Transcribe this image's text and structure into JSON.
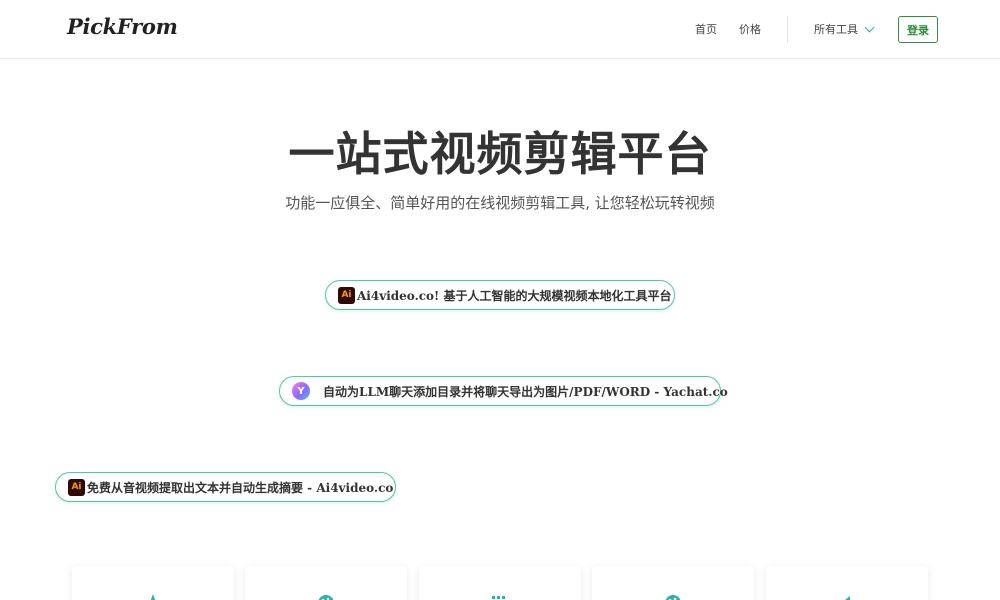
{
  "header": {
    "logo": "PickFrom",
    "nav": {
      "home": "首页",
      "pricing": "价格",
      "all_tools": "所有工具"
    },
    "login": "登录"
  },
  "hero": {
    "title": "一站式视频剪辑平台",
    "subtitle": "功能一应俱全、简单好用的在线视频剪辑工具, 让您轻松玩转视频"
  },
  "promos": [
    {
      "icon": "Ai",
      "text": "Ai4video.co! 基于人工智能的大规模视频本地化工具平台"
    },
    {
      "icon": "Y",
      "text": "自动为LLM聊天添加目录并将聊天导出为图片/PDF/WORD - Yachat.co"
    },
    {
      "icon": "Ai",
      "text": "免费从音视频提取出文本并自动生成摘要 - Ai4video.co"
    }
  ],
  "cards": [
    {
      "icon": "scissors-icon"
    },
    {
      "icon": "palette-icon"
    },
    {
      "icon": "grid-icon"
    },
    {
      "icon": "palette-icon"
    },
    {
      "icon": "speaker-icon"
    }
  ],
  "colors": {
    "accent": "#2bb3a8",
    "pill_border": "#55c7a6",
    "login_green": "#2f8f3f",
    "ai_icon_bg": "#2e0a03",
    "ai_icon_fg": "#ff9a00"
  }
}
